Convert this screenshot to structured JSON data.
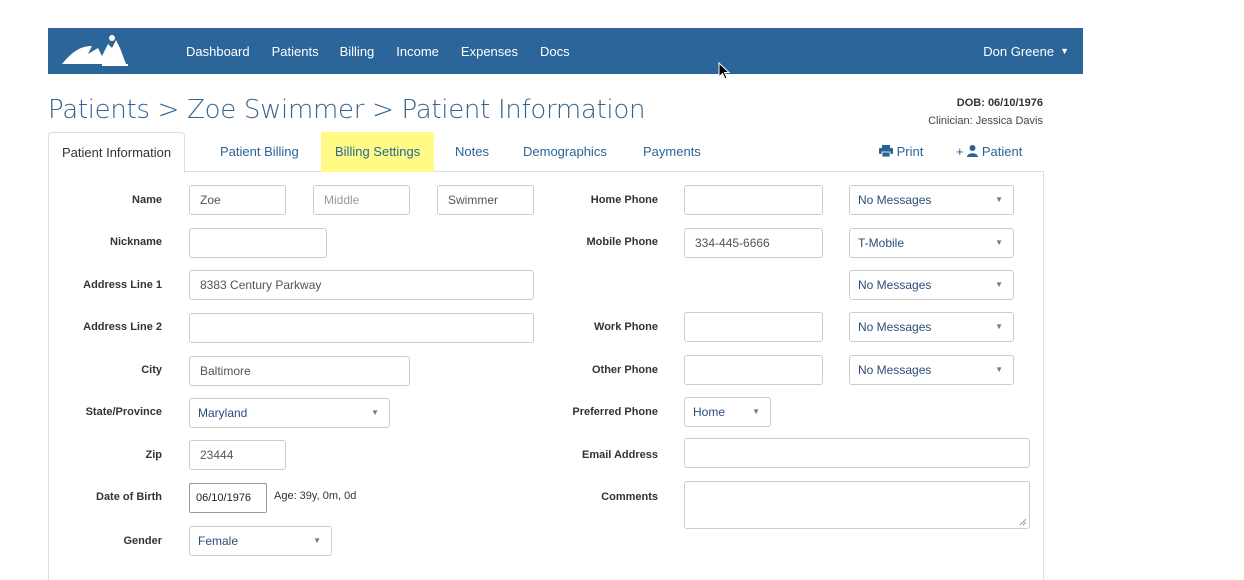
{
  "nav": {
    "links": [
      "Dashboard",
      "Patients",
      "Billing",
      "Income",
      "Expenses",
      "Docs"
    ],
    "user": "Don Greene"
  },
  "header": {
    "breadcrumb_patients": "Patients",
    "breadcrumb_sep1": " > ",
    "breadcrumb_name": "Zoe Swimmer",
    "breadcrumb_sep2": " > ",
    "breadcrumb_page": "Patient Information",
    "dob": "DOB: 06/10/1976",
    "clinician": "Clinician: Jessica Davis"
  },
  "tabs": {
    "patient_information": "Patient Information",
    "patient_billing": "Patient Billing",
    "billing_settings": "Billing Settings",
    "notes": "Notes",
    "demographics": "Demographics",
    "payments": "Payments",
    "print": "Print",
    "add_patient": "+",
    "add_patient_label": "Patient"
  },
  "form": {
    "labels": {
      "name": "Name",
      "nickname": "Nickname",
      "address1": "Address Line 1",
      "address2": "Address Line 2",
      "city": "City",
      "state": "State/Province",
      "zip": "Zip",
      "dob": "Date of Birth",
      "gender": "Gender",
      "home_phone": "Home Phone",
      "mobile_phone": "Mobile Phone",
      "work_phone": "Work Phone",
      "other_phone": "Other Phone",
      "preferred_phone": "Preferred Phone",
      "email": "Email Address",
      "comments": "Comments"
    },
    "values": {
      "first_name": "Zoe",
      "middle_placeholder": "Middle",
      "last_name": "Swimmer",
      "nickname": "",
      "address1": "8383 Century Parkway",
      "address2": "",
      "city": "Baltimore",
      "state": "Maryland",
      "zip": "23444",
      "dob": "06/10/1976",
      "age": "Age: 39y, 0m, 0d",
      "gender": "Female",
      "home_phone": "",
      "mobile_phone": "334-445-6666",
      "work_phone": "",
      "other_phone": "",
      "preferred_phone": "Home",
      "email": "",
      "comments": ""
    },
    "message_selects": {
      "home": "No Messages",
      "mobile_carrier": "T-Mobile",
      "mobile_messages": "No Messages",
      "work": "No Messages",
      "other": "No Messages"
    }
  },
  "colors": {
    "navbar": "#2b6599",
    "link": "#2a6496",
    "highlight_tab": "#fffb86"
  }
}
